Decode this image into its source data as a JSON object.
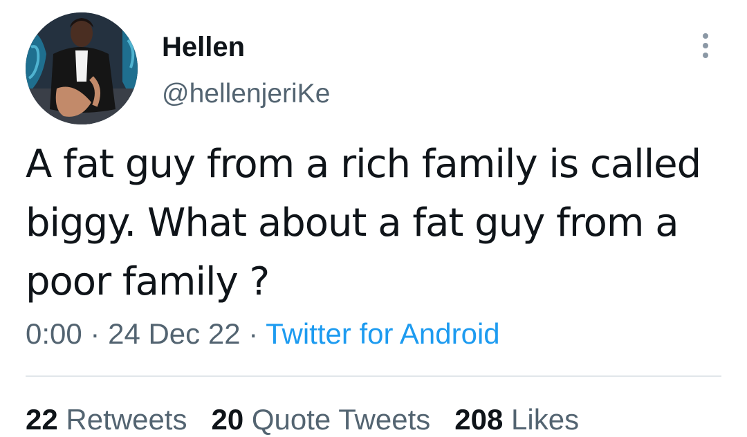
{
  "tweet": {
    "author_name": "Hellen",
    "author_handle": "@hellenjeriKe",
    "text": "A fat guy from a rich family is called biggy. What about a fat guy from a poor family ?",
    "time": "0:00",
    "separator": "·",
    "date": "24 Dec 22",
    "source": "Twitter for Android",
    "stats": {
      "retweets_count": "22",
      "retweets_label": "Retweets",
      "quotes_count": "20",
      "quotes_label": "Quote Tweets",
      "likes_count": "208",
      "likes_label": "Likes"
    }
  },
  "colors": {
    "text": "#0f1419",
    "secondary": "#536471",
    "link": "#1d9bf0",
    "divider": "#e1e6ea"
  },
  "icons": {
    "more": "more-vertical-icon"
  }
}
